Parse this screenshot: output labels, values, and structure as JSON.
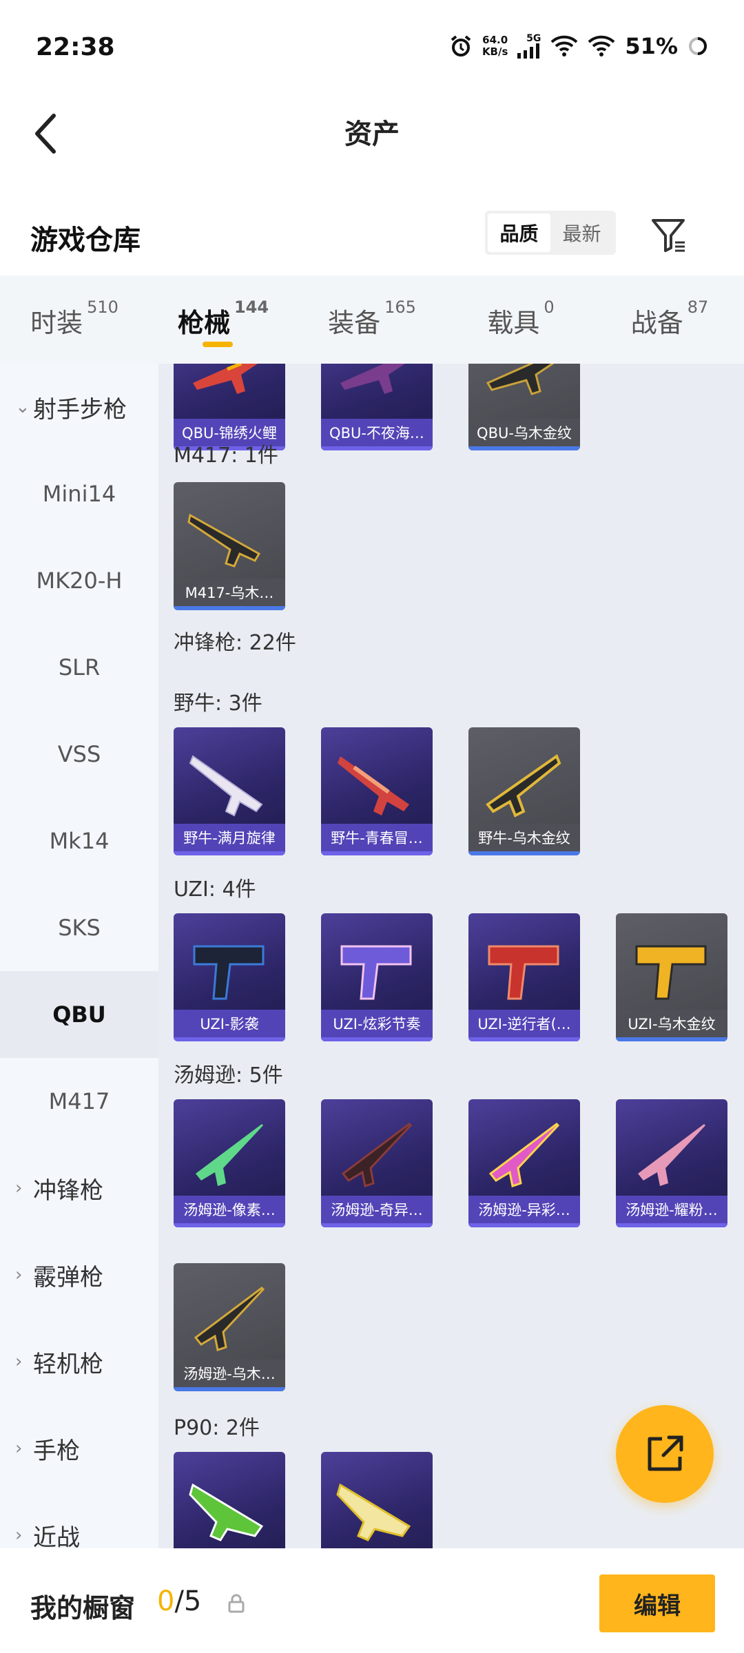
{
  "status_bar": {
    "time": "22:38",
    "net_speed": "64.0",
    "net_unit": "KB/s",
    "network": "5G",
    "battery": "51%"
  },
  "header": {
    "title": "资产"
  },
  "warehouse": {
    "title": "游戏仓库",
    "sort_options": [
      "品质",
      "最新"
    ],
    "active_sort": 0
  },
  "tabs": [
    {
      "label": "时装",
      "count": "510"
    },
    {
      "label": "枪械",
      "count": "144",
      "active": true
    },
    {
      "label": "装备",
      "count": "165"
    },
    {
      "label": "载具",
      "count": "0"
    },
    {
      "label": "战备",
      "count": "87"
    }
  ],
  "sidebar": {
    "group_open": "射手步枪",
    "items": [
      "Mini14",
      "MK20-H",
      "SLR",
      "VSS",
      "Mk14",
      "SKS",
      "QBU",
      "M417"
    ],
    "selected": "QBU",
    "groups": [
      "冲锋枪",
      "霰弹枪",
      "轻机枪",
      "手枪",
      "近战"
    ]
  },
  "content": {
    "qbu_cards": [
      "QBU-锦绣火鲤",
      "QBU-不夜海…",
      "QBU-乌木金纹"
    ],
    "m417_header": "M417: 1件",
    "m417_cards": [
      "M417-乌木…"
    ],
    "smg_header": "冲锋枪: 22件",
    "bison_header": "野牛: 3件",
    "bison_cards": [
      "野牛-满月旋律",
      "野牛-青春冒…",
      "野牛-乌木金纹"
    ],
    "uzi_header": "UZI: 4件",
    "uzi_cards": [
      "UZI-影袭",
      "UZI-炫彩节奏",
      "UZI-逆行者(…",
      "UZI-乌木金纹"
    ],
    "tommy_header": "汤姆逊: 5件",
    "tommy_cards": [
      "汤姆逊-像素…",
      "汤姆逊-奇异…",
      "汤姆逊-异彩…",
      "汤姆逊-耀粉…",
      "汤姆逊-乌木…"
    ],
    "p90_header": "P90: 2件"
  },
  "footer": {
    "title": "我的橱窗",
    "count_used": "0",
    "count_total": "/5",
    "edit_label": "编辑"
  },
  "colors": {
    "accent": "#ffb51b",
    "card_purple": "#2c2566",
    "card_grey": "#4a4a52"
  }
}
